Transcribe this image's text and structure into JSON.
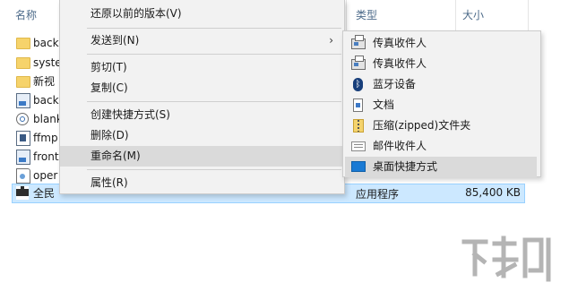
{
  "explorer": {
    "columns": {
      "name": "名称",
      "type": "类型",
      "size": "大小"
    },
    "files": [
      {
        "name": "back",
        "icon": "folder-icon"
      },
      {
        "name": "syste",
        "icon": "folder-icon"
      },
      {
        "name": "新视",
        "icon": "folder-icon"
      },
      {
        "name": "back",
        "icon": "image-file-icon"
      },
      {
        "name": "blank",
        "icon": "settings-file-icon"
      },
      {
        "name": "ffmp",
        "icon": "video-file-icon"
      },
      {
        "name": "front",
        "icon": "image-file-icon"
      },
      {
        "name": "oper",
        "icon": "web-file-icon"
      },
      {
        "name": "全民",
        "icon": "exe-file-icon"
      }
    ],
    "selected_file": {
      "type": "应用程序",
      "size": "85,400 KB"
    }
  },
  "context_menu": {
    "items": [
      {
        "label": "还原以前的版本(V)"
      },
      {
        "label": "发送到(N)",
        "has_submenu": true,
        "submenu_arrow": "›"
      },
      {
        "label": "剪切(T)"
      },
      {
        "label": "复制(C)"
      },
      {
        "label": "创建快捷方式(S)"
      },
      {
        "label": "删除(D)"
      },
      {
        "label": "重命名(M)"
      },
      {
        "label": "属性(R)"
      }
    ]
  },
  "send_to_submenu": {
    "items": [
      {
        "label": "传真收件人",
        "icon": "fax-icon"
      },
      {
        "label": "传真收件人",
        "icon": "fax-icon"
      },
      {
        "label": "蓝牙设备",
        "icon": "bluetooth-icon",
        "glyph": "ᛒ"
      },
      {
        "label": "文档",
        "icon": "document-icon"
      },
      {
        "label": "压缩(zipped)文件夹",
        "icon": "zip-folder-icon"
      },
      {
        "label": "邮件收件人",
        "icon": "mail-icon"
      },
      {
        "label": "桌面快捷方式",
        "icon": "desktop-icon"
      }
    ]
  },
  "colors": {
    "menu_bg": "#f2f2f2",
    "hover_bg": "#dadada",
    "selection_bg": "#cce8ff",
    "header_text": "#4d6b8a"
  }
}
